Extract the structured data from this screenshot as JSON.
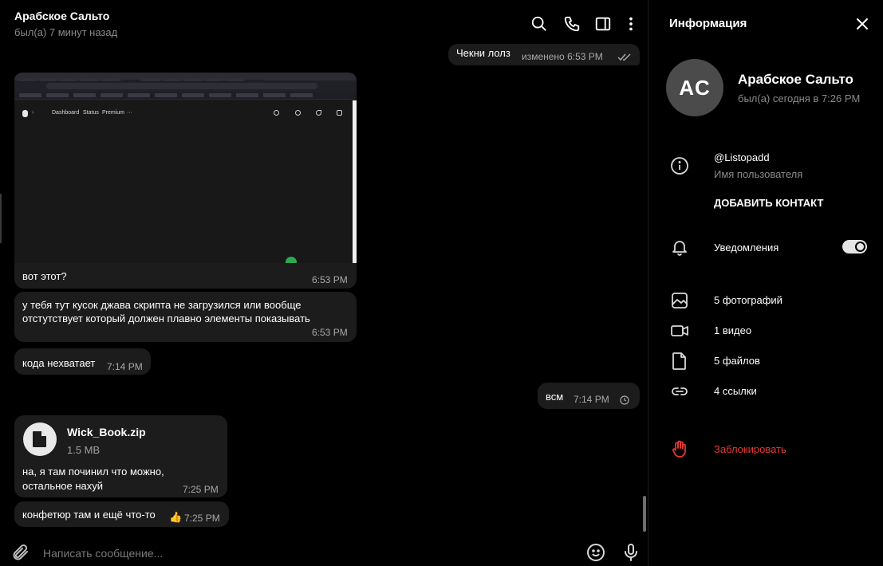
{
  "chat": {
    "title": "Арабское Сальто",
    "status": "был(а) 7 минут назад",
    "icons": [
      "search-icon",
      "phone-icon",
      "sidebar-toggle-icon",
      "more-vertical-icon"
    ],
    "messages": [
      {
        "id": "m1",
        "direction": "out",
        "text": "Чекни лолз",
        "time": "изменено 6:53 PM",
        "status": "read"
      },
      {
        "id": "m2",
        "direction": "in",
        "has_image": true,
        "text": "вот этот?",
        "time": "6:53 PM"
      },
      {
        "id": "m3",
        "direction": "in",
        "text_line1": "у тебя тут кусок джава скрипта не загрузился или вообще",
        "text_line2": "отстутствует который должен плавно элементы показывать",
        "time": "6:53 PM"
      },
      {
        "id": "m4",
        "direction": "in",
        "text": "кода нехватает",
        "time": "7:14 PM"
      },
      {
        "id": "m5",
        "direction": "out",
        "text": "всм",
        "time": "7:14 PM",
        "status": "pending"
      },
      {
        "id": "m6",
        "direction": "in",
        "file_name": "Wick_Book.zip",
        "file_size": "1.5 MB",
        "text_line1": "на, я там починил что можно,",
        "text_line2": "остальное нахуй",
        "time": "7:25 PM"
      },
      {
        "id": "m7",
        "direction": "in",
        "text": "конфетюр там и ещё что-то",
        "reaction": "👍",
        "time": "7:25 PM"
      }
    ],
    "image_preview": {
      "nav_items": [
        "Dashboard",
        "Status",
        "Premium",
        "···"
      ]
    },
    "composer": {
      "placeholder": "Написать сообщение...",
      "icons": [
        "attach-icon",
        "emoji-icon",
        "microphone-icon"
      ]
    }
  },
  "info": {
    "title": "Информация",
    "avatar_initials": "AC",
    "name": "Арабское Сальто",
    "last_seen": "был(а) сегодня в 7:26 PM",
    "username": "@Listopadd",
    "username_label": "Имя пользователя",
    "add_contact": "Добавить контакт",
    "notifications_label": "Уведомления",
    "notifications_on": true,
    "media": {
      "photos": "5 фотографий",
      "videos": "1 видео",
      "files": "5 файлов",
      "links": "4 ссылки"
    },
    "block": "Заблокировать",
    "colors": {
      "accent_danger": "#e53935",
      "bubble": "#1c1c1d",
      "avatar": "#4b4b4b"
    }
  }
}
